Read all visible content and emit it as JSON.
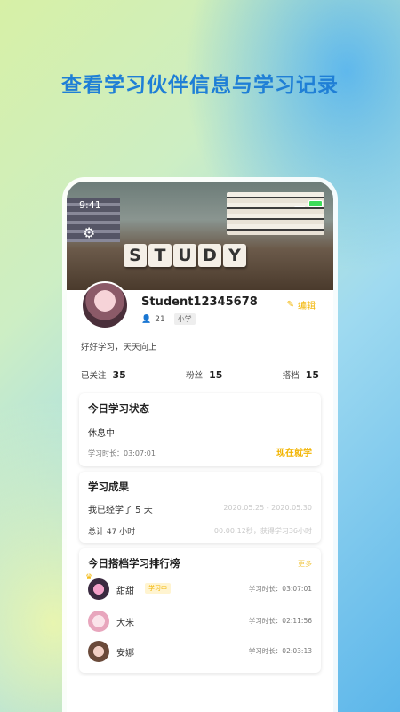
{
  "headline": "查看学习伙伴信息与学习记录",
  "status": {
    "time": "9:41"
  },
  "banner": {
    "letters": [
      "S",
      "T",
      "U",
      "D",
      "Y"
    ]
  },
  "profile": {
    "username": "Student12345678",
    "edit_label": "编辑",
    "likes": "21",
    "grade": "小学",
    "bio": "好好学习，天天向上"
  },
  "stats": {
    "following_label": "已关注",
    "following": "35",
    "fans_label": "粉丝",
    "fans": "15",
    "partners_label": "搭档",
    "partners": "15"
  },
  "today_status": {
    "title": "今日学习状态",
    "state": "休息中",
    "duration_label": "学习时长：03:07:01",
    "action_label": "现在就学"
  },
  "achievements": {
    "title": "学习成果",
    "days_text": "我已经学了 5 天",
    "date_range": "2020.05.25 - 2020.05.30",
    "total_text": "总计 47 小时",
    "detail_text": "00:00:12秒，获得学习36小时"
  },
  "ranking": {
    "title": "今日搭档学习排行榜",
    "more_label": "更多",
    "items": [
      {
        "name": "甜甜",
        "badge": "学习中",
        "time": "学习时长：03:07:01"
      },
      {
        "name": "大米",
        "badge": "",
        "time": "学习时长：02:11:56"
      },
      {
        "name": "安娜",
        "badge": "",
        "time": "学习时长：02:03:13"
      }
    ]
  },
  "colors": {
    "accent": "#f2b400",
    "headline": "#1f7fd6"
  }
}
